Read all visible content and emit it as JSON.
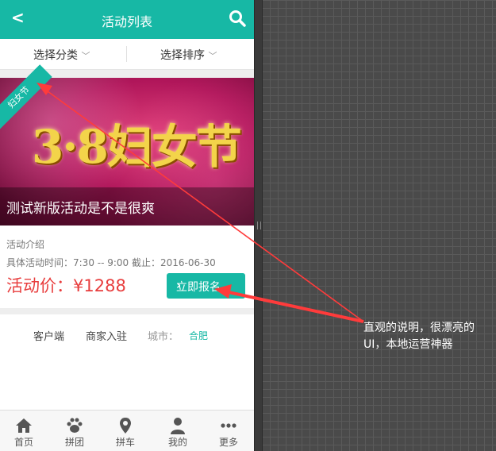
{
  "header": {
    "title": "活动列表",
    "back_icon": "chevron-left-icon",
    "search_icon": "search-icon"
  },
  "filters": {
    "category": "选择分类",
    "sort": "选择排序"
  },
  "banner": {
    "badge": "妇女节",
    "artwork_text": "3·8妇女节",
    "caption": "测试新版活动是不是很爽"
  },
  "event": {
    "intro": "活动介绍",
    "time": "具体活动时间：7:30 -- 9:00 截止：2016-06-30",
    "price": "活动价：¥1288",
    "signup": "立即报名"
  },
  "footer": {
    "client": "客户端",
    "merchant": "商家入驻",
    "city_label": "城市：",
    "city": "合肥"
  },
  "tabs": [
    {
      "label": "首页",
      "icon": "home-icon"
    },
    {
      "label": "拼团",
      "icon": "paw-icon"
    },
    {
      "label": "拼车",
      "icon": "map-pin-icon"
    },
    {
      "label": "我的",
      "icon": "user-icon"
    },
    {
      "label": "更多",
      "icon": "more-icon"
    }
  ],
  "annotation": {
    "line1": "直观的说明，很漂亮的",
    "line2": "UI，本地运营神器"
  },
  "colors": {
    "accent": "#17b8a5",
    "price": "#e83d3d",
    "arrow": "#ff3b3b"
  }
}
